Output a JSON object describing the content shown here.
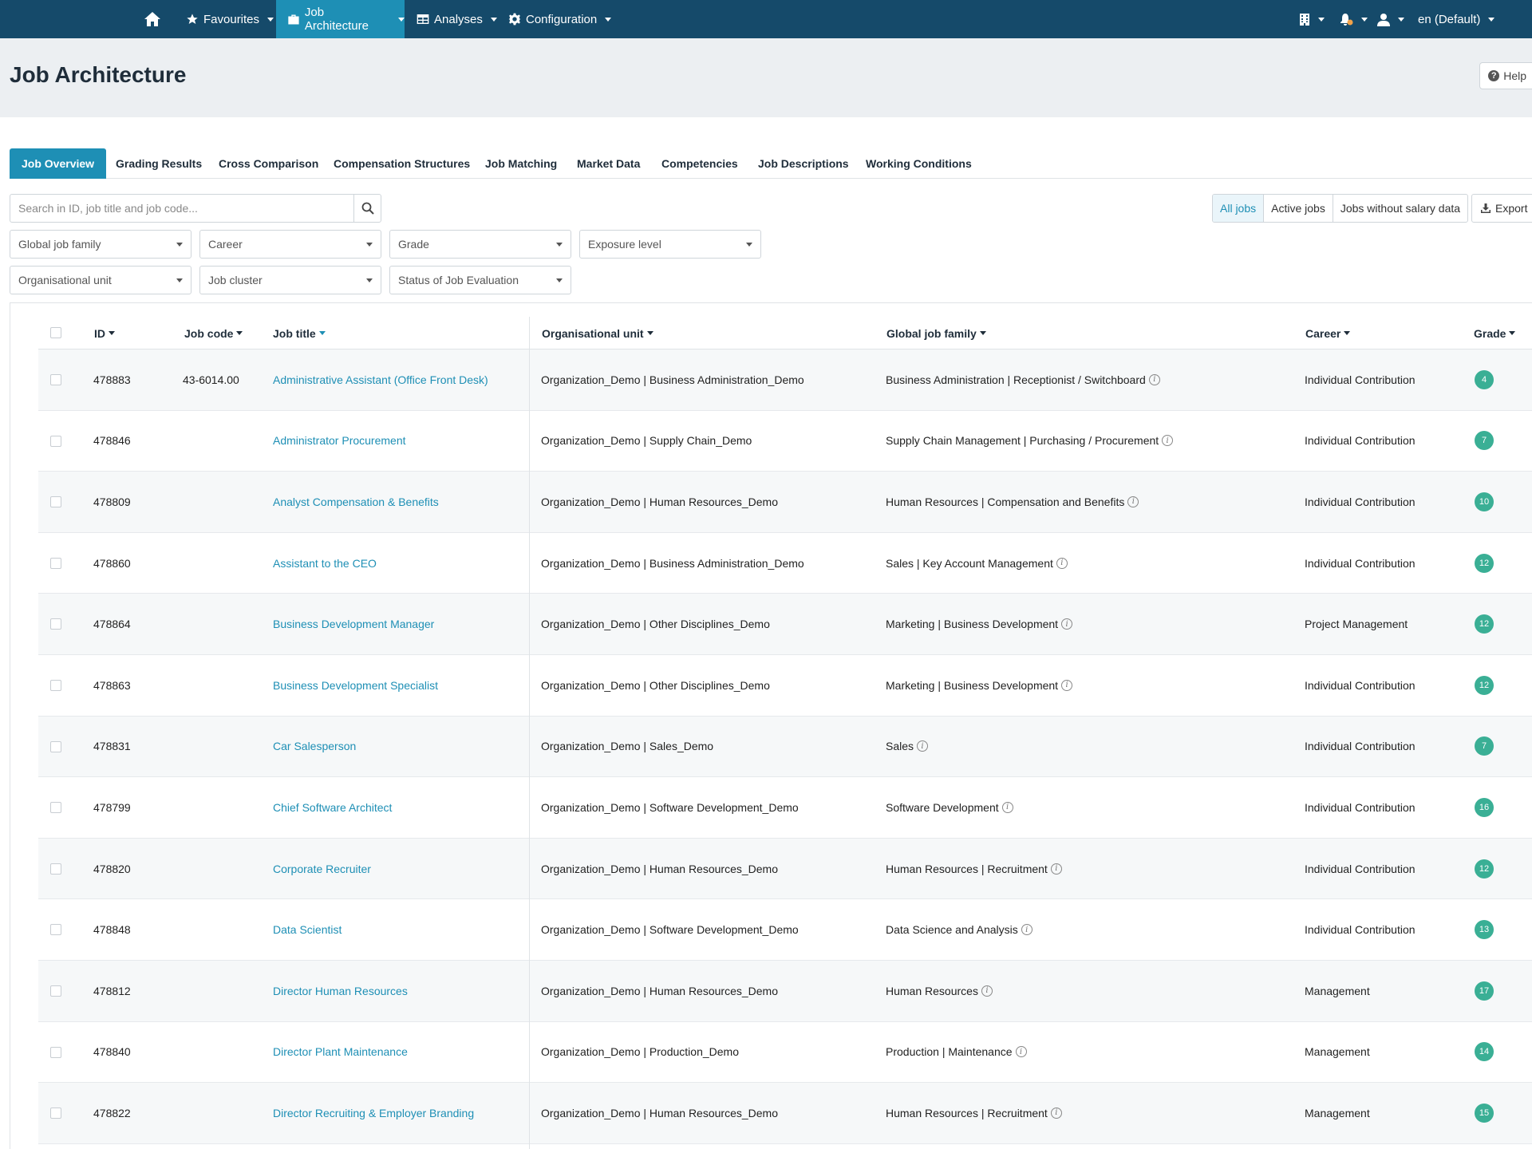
{
  "nav": {
    "favourites": "Favourites",
    "job_architecture": "Job Architecture",
    "analyses": "Analyses",
    "configuration": "Configuration",
    "language": "en (Default)"
  },
  "header": {
    "title": "Job Architecture",
    "help": "Help"
  },
  "tabs": [
    "Job Overview",
    "Grading Results",
    "Cross Comparison",
    "Compensation Structures",
    "Job Matching",
    "Market Data",
    "Competencies",
    "Job Descriptions",
    "Working Conditions"
  ],
  "search": {
    "placeholder": "Search in ID, job title and job code..."
  },
  "job_filter": {
    "all": "All jobs",
    "active": "Active jobs",
    "without_salary": "Jobs without salary data"
  },
  "export": "Export",
  "filters": {
    "global_job_family": "Global job family",
    "career": "Career",
    "grade": "Grade",
    "exposure_level": "Exposure level",
    "organisational_unit": "Organisational unit",
    "job_cluster": "Job cluster",
    "status": "Status of Job Evaluation"
  },
  "table": {
    "columns": {
      "id": "ID",
      "job_code": "Job code",
      "job_title": "Job title",
      "org_unit": "Organisational unit",
      "job_family": "Global job family",
      "career": "Career",
      "grade": "Grade"
    },
    "rows": [
      {
        "id": "478883",
        "code": "43-6014.00",
        "title": "Administrative Assistant (Office Front Desk)",
        "org": "Organization_Demo | Business Administration_Demo",
        "family": "Business Administration | Receptionist / Switchboard",
        "career": "Individual Contribution",
        "grade": "4"
      },
      {
        "id": "478846",
        "code": "",
        "title": "Administrator Procurement",
        "org": "Organization_Demo | Supply Chain_Demo",
        "family": "Supply Chain Management | Purchasing / Procurement",
        "career": "Individual Contribution",
        "grade": "7"
      },
      {
        "id": "478809",
        "code": "",
        "title": "Analyst Compensation & Benefits",
        "org": "Organization_Demo | Human Resources_Demo",
        "family": "Human Resources | Compensation and Benefits",
        "career": "Individual Contribution",
        "grade": "10"
      },
      {
        "id": "478860",
        "code": "",
        "title": "Assistant to the CEO",
        "org": "Organization_Demo | Business Administration_Demo",
        "family": "Sales | Key Account Management",
        "career": "Individual Contribution",
        "grade": "12"
      },
      {
        "id": "478864",
        "code": "",
        "title": "Business Development Manager",
        "org": "Organization_Demo | Other Disciplines_Demo",
        "family": "Marketing | Business Development",
        "career": "Project Management",
        "grade": "12"
      },
      {
        "id": "478863",
        "code": "",
        "title": "Business Development Specialist",
        "org": "Organization_Demo | Other Disciplines_Demo",
        "family": "Marketing | Business Development",
        "career": "Individual Contribution",
        "grade": "12"
      },
      {
        "id": "478831",
        "code": "",
        "title": "Car Salesperson",
        "org": "Organization_Demo | Sales_Demo",
        "family": "Sales",
        "career": "Individual Contribution",
        "grade": "7"
      },
      {
        "id": "478799",
        "code": "",
        "title": "Chief Software Architect",
        "org": "Organization_Demo | Software Development_Demo",
        "family": "Software Development",
        "career": "Individual Contribution",
        "grade": "16"
      },
      {
        "id": "478820",
        "code": "",
        "title": "Corporate Recruiter",
        "org": "Organization_Demo | Human Resources_Demo",
        "family": "Human Resources | Recruitment",
        "career": "Individual Contribution",
        "grade": "12"
      },
      {
        "id": "478848",
        "code": "",
        "title": "Data Scientist",
        "org": "Organization_Demo | Software Development_Demo",
        "family": "Data Science and Analysis",
        "career": "Individual Contribution",
        "grade": "13"
      },
      {
        "id": "478812",
        "code": "",
        "title": "Director Human Resources",
        "org": "Organization_Demo | Human Resources_Demo",
        "family": "Human Resources",
        "career": "Management",
        "grade": "17"
      },
      {
        "id": "478840",
        "code": "",
        "title": "Director Plant Maintenance",
        "org": "Organization_Demo | Production_Demo",
        "family": "Production | Maintenance",
        "career": "Management",
        "grade": "14"
      },
      {
        "id": "478822",
        "code": "",
        "title": "Director Recruiting & Employer Branding",
        "org": "Organization_Demo | Human Resources_Demo",
        "family": "Human Resources | Recruitment",
        "career": "Management",
        "grade": "15"
      }
    ]
  },
  "colors": {
    "nav_bg": "#154a6a",
    "accent": "#1e8fb5",
    "grade_badge": "#3aaf95"
  },
  "icons": [
    "home-icon",
    "star-icon",
    "briefcase-icon",
    "table-icon",
    "gear-icon",
    "building-icon",
    "bell-icon",
    "user-icon",
    "search-icon",
    "download-icon",
    "info-icon",
    "help-icon"
  ]
}
